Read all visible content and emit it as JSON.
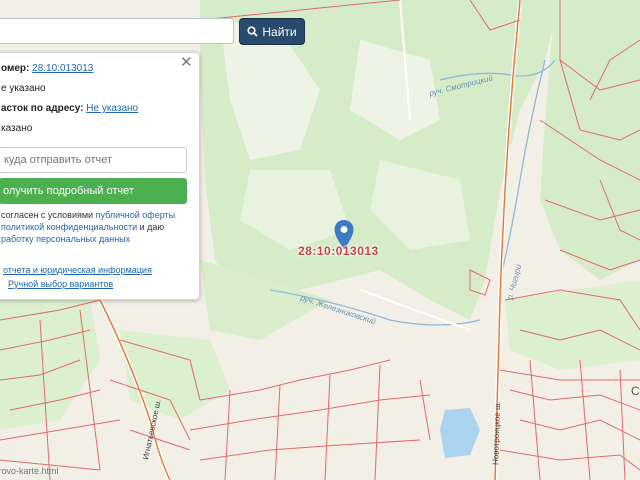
{
  "search": {
    "value": "",
    "button_label": "Найти",
    "button_icon": "search-icon"
  },
  "panel": {
    "cadnum_label": "омер:",
    "cadnum_value": "28:10:013013",
    "row2": "е указано",
    "address_label": "асток по адресу:",
    "address_value": "Не указано",
    "row4": "казано",
    "email_placeholder": "куда отправить отчет",
    "report_button": "олучить подробный отчет",
    "consent_prefix": "согласен с условиями",
    "offer_link": "публичной оферты",
    "privacy_link": "политикой конфиденциальности",
    "consent_middle": "и даю",
    "processing_link": "работку персональных данных",
    "info_link": "отчета и юридическая информация",
    "manual_link": "Ручной выбор вариантов"
  },
  "map": {
    "label": "28:10:013013",
    "streams": [
      "руч. Смотрицкий",
      "руч. Железниковский",
      "р. Чигири"
    ],
    "streets": [
      "Новотроицкое ш.",
      "Игнатьевское ш."
    ],
    "corner_text": "trovo-karte.html",
    "edge_letter": "С",
    "colors": {
      "forest": "#d6ecc8",
      "open": "#f2efe6",
      "parcel": "#e06b6b",
      "water": "#a9d3ef",
      "road": "#ffffff"
    }
  }
}
